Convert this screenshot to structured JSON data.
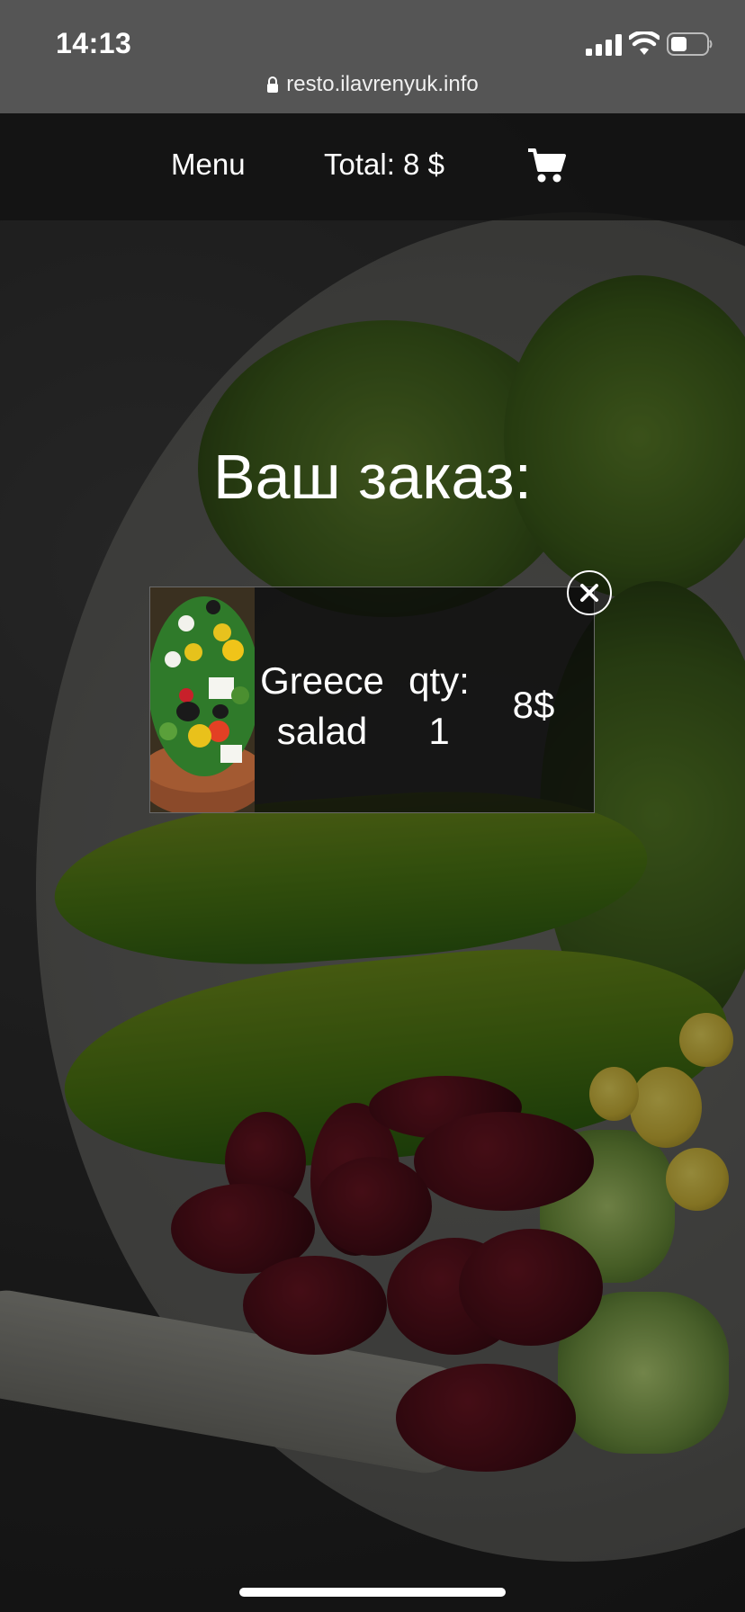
{
  "status_bar": {
    "time": "14:13"
  },
  "browser": {
    "url": "resto.ilavrenyuk.info"
  },
  "header": {
    "menu_label": "Menu",
    "total_label": "Total: 8 $",
    "cart_icon": "shopping-cart-icon"
  },
  "order": {
    "title": "Ваш заказ:",
    "items": [
      {
        "name_line1": "Greece",
        "name_line2": "salad",
        "qty_label": "qty:",
        "qty_value": "1",
        "price": "8$",
        "remove_icon": "close-icon"
      }
    ]
  },
  "colors": {
    "header_bg": "#121212",
    "browser_bar_bg": "#555555",
    "text": "#ffffff"
  }
}
